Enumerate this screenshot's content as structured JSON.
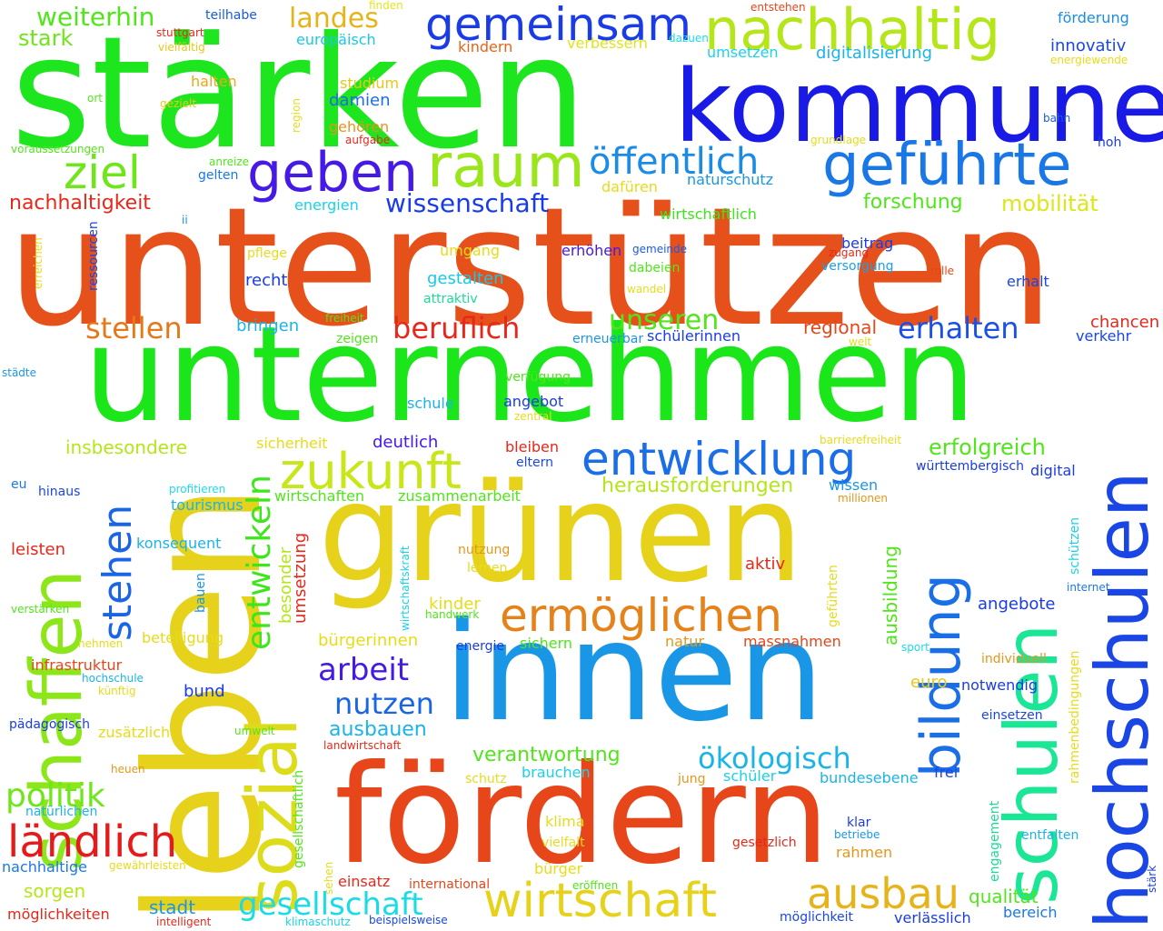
{
  "words": [
    {
      "text": "stärken",
      "color": "#1ee61e"
    },
    {
      "text": "kommune",
      "color": "#1a1ae6"
    },
    {
      "text": "unterstützen",
      "color": "#e6501a"
    },
    {
      "text": "unternehmen",
      "color": "#1ae61a"
    },
    {
      "text": "grünen",
      "color": "#e6c81a"
    },
    {
      "text": "innen",
      "color": "#1a96e6"
    },
    {
      "text": "fördern",
      "color": "#e6461a"
    },
    {
      "text": "leben",
      "color": "#e6d21a"
    },
    {
      "text": "schaffen",
      "color": "#8ce61a"
    },
    {
      "text": "sozial",
      "color": "#dcdc1a"
    },
    {
      "text": "schulen",
      "color": "#1ae696"
    },
    {
      "text": "hochschulen",
      "color": "#1a46e6"
    },
    {
      "text": "bildung",
      "color": "#1a6ee6"
    },
    {
      "text": "nachhaltig",
      "color": "#b4e61a"
    },
    {
      "text": "gemeinsam",
      "color": "#1a3ce6"
    },
    {
      "text": "geführte",
      "color": "#1a78e6"
    },
    {
      "text": "raum",
      "color": "#9ae61a"
    },
    {
      "text": "geben",
      "color": "#461ae6"
    },
    {
      "text": "ziel",
      "color": "#6ee61a"
    },
    {
      "text": "öffentlich",
      "color": "#1a8ce6"
    },
    {
      "text": "zukunft",
      "color": "#c8e61a"
    },
    {
      "text": "entwicklung",
      "color": "#1a6ee6"
    },
    {
      "text": "ermöglichen",
      "color": "#e6821a"
    },
    {
      "text": "wirtschaft",
      "color": "#e6d21a"
    },
    {
      "text": "ausbau",
      "color": "#e6b41a"
    },
    {
      "text": "ländlich",
      "color": "#e61a1a"
    },
    {
      "text": "gesellschaft",
      "color": "#1adce6"
    },
    {
      "text": "stehen",
      "color": "#1a64e6"
    },
    {
      "text": "entwickeln",
      "color": "#3ce61a"
    },
    {
      "text": "arbeit",
      "color": "#461ae6"
    },
    {
      "text": "nutzen",
      "color": "#1a64e6"
    },
    {
      "text": "politik",
      "color": "#6ee61a"
    },
    {
      "text": "beruflich",
      "color": "#e6281a"
    },
    {
      "text": "stellen",
      "color": "#e6781a"
    },
    {
      "text": "unseren",
      "color": "#50e61a"
    },
    {
      "text": "erhalten",
      "color": "#1a50e6"
    },
    {
      "text": "landes",
      "color": "#e6b41a"
    },
    {
      "text": "weiterhin",
      "color": "#50e61a"
    },
    {
      "text": "stark",
      "color": "#6ee61a"
    },
    {
      "text": "teilhabe",
      "color": "#1a5ae6"
    },
    {
      "text": "finden",
      "color": "#e6e61a"
    },
    {
      "text": "europäisch",
      "color": "#1ac8e6"
    },
    {
      "text": "vielfältig",
      "color": "#e6c81a"
    },
    {
      "text": "kindern",
      "color": "#e6641a"
    },
    {
      "text": "verbessern",
      "color": "#dce61a"
    },
    {
      "text": "umsetzen",
      "color": "#1ad2e6"
    },
    {
      "text": "dazuen",
      "color": "#1adce6"
    },
    {
      "text": "entstehen",
      "color": "#e6461a"
    },
    {
      "text": "förderung",
      "color": "#1a8ce6"
    },
    {
      "text": "innovativ",
      "color": "#1a46e6"
    },
    {
      "text": "digitalisierung",
      "color": "#1ab4e6"
    },
    {
      "text": "energiewende",
      "color": "#e6dc1a"
    },
    {
      "text": "studium",
      "color": "#e6c81a"
    },
    {
      "text": "ort",
      "color": "#50e61a"
    },
    {
      "text": "halten",
      "color": "#e6aa1a"
    },
    {
      "text": "damien",
      "color": "#1a6ee6"
    },
    {
      "text": "gezielt",
      "color": "#e6c81a"
    },
    {
      "text": "region",
      "color": "#e6dc1a"
    },
    {
      "text": "stuttgart",
      "color": "#e6281a"
    },
    {
      "text": "gehören",
      "color": "#e6961a"
    },
    {
      "text": "aufgabe",
      "color": "#e6281a"
    },
    {
      "text": "voraussetzungen",
      "color": "#50e61a"
    },
    {
      "text": "anreize",
      "color": "#50e61a"
    },
    {
      "text": "gelten",
      "color": "#1a78e6"
    },
    {
      "text": "bahn",
      "color": "#1a5ae6"
    },
    {
      "text": "grundlage",
      "color": "#e6dc1a"
    },
    {
      "text": "hoh",
      "color": "#1a3ce6"
    },
    {
      "text": "nachhaltigkeit",
      "color": "#e6281a"
    },
    {
      "text": "wissenschaft",
      "color": "#1a3ce6"
    },
    {
      "text": "dafüren",
      "color": "#e6dc1a"
    },
    {
      "text": "naturschutz",
      "color": "#1a96e6"
    },
    {
      "text": "forschung",
      "color": "#50e61a"
    },
    {
      "text": "mobilität",
      "color": "#dce61a"
    },
    {
      "text": "energien",
      "color": "#1ad2e6"
    },
    {
      "text": "wirtschaftlich",
      "color": "#3ce61a"
    },
    {
      "text": "ii",
      "color": "#1a8ce6"
    },
    {
      "text": "erreichen",
      "color": "#e6dc1a"
    },
    {
      "text": "ressourcen",
      "color": "#1a46e6"
    },
    {
      "text": "pflege",
      "color": "#e6dc1a"
    },
    {
      "text": "umgang",
      "color": "#e6dc1a"
    },
    {
      "text": "erhöhen",
      "color": "#461ae6"
    },
    {
      "text": "gemeinde",
      "color": "#1a5ae6"
    },
    {
      "text": "zugang",
      "color": "#e6281a"
    },
    {
      "text": "beitrag",
      "color": "#1a3ce6"
    },
    {
      "text": "versorgung",
      "color": "#1aa0e6"
    },
    {
      "text": "rolle",
      "color": "#e6461a"
    },
    {
      "text": "erhalt",
      "color": "#1a46e6"
    },
    {
      "text": "recht",
      "color": "#1a3ce6"
    },
    {
      "text": "gestalten",
      "color": "#1ac8e6"
    },
    {
      "text": "dabeien",
      "color": "#50e61a"
    },
    {
      "text": "wandel",
      "color": "#e6dc1a"
    },
    {
      "text": "attraktiv",
      "color": "#1adc96"
    },
    {
      "text": "freiheit",
      "color": "#50e61a"
    },
    {
      "text": "bringen",
      "color": "#1ab4e6"
    },
    {
      "text": "zeigen",
      "color": "#50e61a"
    },
    {
      "text": "erneuerbar",
      "color": "#1a96e6"
    },
    {
      "text": "schülerinnen",
      "color": "#1a3ce6"
    },
    {
      "text": "regional",
      "color": "#e6461a"
    },
    {
      "text": "welt",
      "color": "#e6dc1a"
    },
    {
      "text": "chancen",
      "color": "#e6281a"
    },
    {
      "text": "verkehr",
      "color": "#1a46e6"
    },
    {
      "text": "städte",
      "color": "#1a96e6"
    },
    {
      "text": "verfügung",
      "color": "#50e61a"
    },
    {
      "text": "schule",
      "color": "#1ab4e6"
    },
    {
      "text": "angebot",
      "color": "#1a3ce6"
    },
    {
      "text": "zentral",
      "color": "#e6dc1a"
    },
    {
      "text": "insbesondere",
      "color": "#b4e61a"
    },
    {
      "text": "sicherheit",
      "color": "#e6dc1a"
    },
    {
      "text": "deutlich",
      "color": "#461ae6"
    },
    {
      "text": "bleiben",
      "color": "#e6281a"
    },
    {
      "text": "eltern",
      "color": "#1a46e6"
    },
    {
      "text": "barrierefreiheit",
      "color": "#e6dc1a"
    },
    {
      "text": "erfolgreich",
      "color": "#50e61a"
    },
    {
      "text": "württembergisch",
      "color": "#1a3ce6"
    },
    {
      "text": "digital",
      "color": "#1a3ce6"
    },
    {
      "text": "eu",
      "color": "#1a78e6"
    },
    {
      "text": "hinaus",
      "color": "#1a46e6"
    },
    {
      "text": "profitieren",
      "color": "#1adce6"
    },
    {
      "text": "tourismus",
      "color": "#1ab4e6"
    },
    {
      "text": "wirtschaften",
      "color": "#50e61a"
    },
    {
      "text": "zusammenarbeit",
      "color": "#50e61a"
    },
    {
      "text": "herausforderungen",
      "color": "#b4e61a"
    },
    {
      "text": "wissen",
      "color": "#1a96e6"
    },
    {
      "text": "millionen",
      "color": "#e6961a"
    },
    {
      "text": "leisten",
      "color": "#e6281a"
    },
    {
      "text": "konsequent",
      "color": "#1ab4e6"
    },
    {
      "text": "besonder",
      "color": "#b4e61a"
    },
    {
      "text": "umsetzung",
      "color": "#e6281a"
    },
    {
      "text": "wirtschaftskraft",
      "color": "#1ad2e6"
    },
    {
      "text": "nutzung",
      "color": "#e6961a"
    },
    {
      "text": "lernen",
      "color": "#e6dc1a"
    },
    {
      "text": "aktiv",
      "color": "#e6281a"
    },
    {
      "text": "geführten",
      "color": "#e6dc1a"
    },
    {
      "text": "ausbildung",
      "color": "#50e61a"
    },
    {
      "text": "schützen",
      "color": "#1ad2e6"
    },
    {
      "text": "internet",
      "color": "#1a78e6"
    },
    {
      "text": "verstärken",
      "color": "#50e61a"
    },
    {
      "text": "bauen",
      "color": "#1a96e6"
    },
    {
      "text": "kinder",
      "color": "#e6dc1a"
    },
    {
      "text": "handwerk",
      "color": "#50e61a"
    },
    {
      "text": "angebote",
      "color": "#1a3ce6"
    },
    {
      "text": "nehmen",
      "color": "#e6dc1a"
    },
    {
      "text": "beteiligung",
      "color": "#e6dc1a"
    },
    {
      "text": "bürgerinnen",
      "color": "#e6dc1a"
    },
    {
      "text": "energie",
      "color": "#1a3ce6"
    },
    {
      "text": "sichern",
      "color": "#50e61a"
    },
    {
      "text": "natur",
      "color": "#e6961a"
    },
    {
      "text": "massnahmen",
      "color": "#e6461a"
    },
    {
      "text": "sport",
      "color": "#1adce6"
    },
    {
      "text": "rahmenbedingungen",
      "color": "#e6dc1a"
    },
    {
      "text": "individuell",
      "color": "#e6961a"
    },
    {
      "text": "infrastruktur",
      "color": "#e6461a"
    },
    {
      "text": "hochschule",
      "color": "#1ab4e6"
    },
    {
      "text": "künftig",
      "color": "#e6dc1a"
    },
    {
      "text": "bund",
      "color": "#1a3ce6"
    },
    {
      "text": "euro",
      "color": "#e6c81a"
    },
    {
      "text": "notwendig",
      "color": "#1a3ce6"
    },
    {
      "text": "pädagogisch",
      "color": "#1a3ce6"
    },
    {
      "text": "zusätzlich",
      "color": "#e6dc1a"
    },
    {
      "text": "umwelt",
      "color": "#50e61a"
    },
    {
      "text": "gesellschaftlich",
      "color": "#50e61a"
    },
    {
      "text": "ausbauen",
      "color": "#1ab4e6"
    },
    {
      "text": "landwirtschaft",
      "color": "#e6281a"
    },
    {
      "text": "einsetzen",
      "color": "#1a46e6"
    },
    {
      "text": "verantwortung",
      "color": "#50e61a"
    },
    {
      "text": "ökologisch",
      "color": "#1ab4e6"
    },
    {
      "text": "engagement",
      "color": "#1adc96"
    },
    {
      "text": "heuen",
      "color": "#e6961a"
    },
    {
      "text": "brauchen",
      "color": "#1ad2e6"
    },
    {
      "text": "schutz",
      "color": "#e6dc1a"
    },
    {
      "text": "jung",
      "color": "#e6961a"
    },
    {
      "text": "schüler",
      "color": "#1ad2e6"
    },
    {
      "text": "bundesebene",
      "color": "#1ab4e6"
    },
    {
      "text": "frei",
      "color": "#1a46e6"
    },
    {
      "text": "natürlichen",
      "color": "#1ab4e6"
    },
    {
      "text": "klima",
      "color": "#e6dc1a"
    },
    {
      "text": "klar",
      "color": "#1a3ce6"
    },
    {
      "text": "betriebe",
      "color": "#1a96e6"
    },
    {
      "text": "entfalten",
      "color": "#1ab4e6"
    },
    {
      "text": "vielfalt",
      "color": "#e6dc1a"
    },
    {
      "text": "gesetzlich",
      "color": "#e6281a"
    },
    {
      "text": "rahmen",
      "color": "#e6961a"
    },
    {
      "text": "nachhaltige",
      "color": "#1a78e6"
    },
    {
      "text": "gewährleisten",
      "color": "#e6dc1a"
    },
    {
      "text": "bürger",
      "color": "#e6dc1a"
    },
    {
      "text": "sehen",
      "color": "#e6dc1a"
    },
    {
      "text": "sorgen",
      "color": "#b4e61a"
    },
    {
      "text": "einsatz",
      "color": "#e6281a"
    },
    {
      "text": "international",
      "color": "#e6461a"
    },
    {
      "text": "eröffnen",
      "color": "#50e61a"
    },
    {
      "text": "qualität",
      "color": "#50e61a"
    },
    {
      "text": "bereich",
      "color": "#1a78e6"
    },
    {
      "text": "stärk",
      "color": "#1a3ce6"
    },
    {
      "text": "stadt",
      "color": "#1a96e6"
    },
    {
      "text": "möglichkeiten",
      "color": "#e6281a"
    },
    {
      "text": "intelligent",
      "color": "#e6281a"
    },
    {
      "text": "klimaschutz",
      "color": "#1ad2e6"
    },
    {
      "text": "beispielsweise",
      "color": "#1a46e6"
    },
    {
      "text": "möglichkeit",
      "color": "#1a46e6"
    },
    {
      "text": "verlässlich",
      "color": "#1a3ce6"
    }
  ]
}
